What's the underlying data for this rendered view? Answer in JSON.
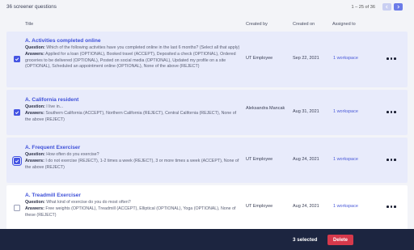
{
  "toolbar": {
    "title": "36 screener questions",
    "pagination": "1 – 25 of 36",
    "prev_icon": "chevron-left-icon",
    "next_icon": "chevron-right-icon"
  },
  "columns": {
    "title": "Title",
    "created_by": "Created by",
    "created_on": "Created on",
    "assigned_to": "Assigned to"
  },
  "labels": {
    "question": "Question:",
    "answers": "Answers:"
  },
  "rows": [
    {
      "selected": true,
      "title": "A. Activities completed online",
      "question": "Which of the following activities have you completed online in the last 6 months? (Select all that apply)",
      "answers": "Applied for a loan (OPTIONAL), Booked travel (ACCEPT), Deposited a check (OPTIONAL), Ordered groceries to be delivered (OPTIONAL), Posted on social media (OPTIONAL), Updated my profile on a site (OPTIONAL), Scheduled an appointment online (OPTIONAL), None of the above (REJECT)",
      "created_by": "UT Employee",
      "created_on": "Sep 22, 2021",
      "assigned_to": "1 workspace"
    },
    {
      "selected": true,
      "title": "A. California resident",
      "question": "I live in...",
      "answers": "Southern California (ACCEPT), Northern California (REJECT), Central California (REJECT), None of the above (REJECT)",
      "created_by": "Aleksandra Mancak",
      "created_on": "Aug 31, 2021",
      "assigned_to": "1 workspace"
    },
    {
      "selected": true,
      "title": "A. Frequent Exerciser",
      "question": "How often do you exercise?",
      "answers": "I do not exercise (REJECT), 1-2 times a week (REJECT), 3 or more times a week (ACCEPT), None of the above (REJECT)",
      "created_by": "UT Employee",
      "created_on": "Aug 24, 2021",
      "assigned_to": "1 workspace"
    },
    {
      "selected": false,
      "title": "A. Treadmill Exerciser",
      "question": "What kind of exercise do you do most often?",
      "answers": "Free weights (OPTIONAL), Treadmill (ACCEPT), Elliptical (OPTIONAL), Yoga (OPTIONAL), None of these (REJECT)",
      "created_by": "UT Employee",
      "created_on": "Aug 24, 2021",
      "assigned_to": "1 workspace"
    }
  ],
  "footer": {
    "selected_count": "3 selected",
    "delete_label": "Delete"
  },
  "colors": {
    "accent": "#4555e3",
    "selected_row": "#e8ebfb",
    "footer_bg": "#1c2540",
    "delete": "#d6394b"
  }
}
